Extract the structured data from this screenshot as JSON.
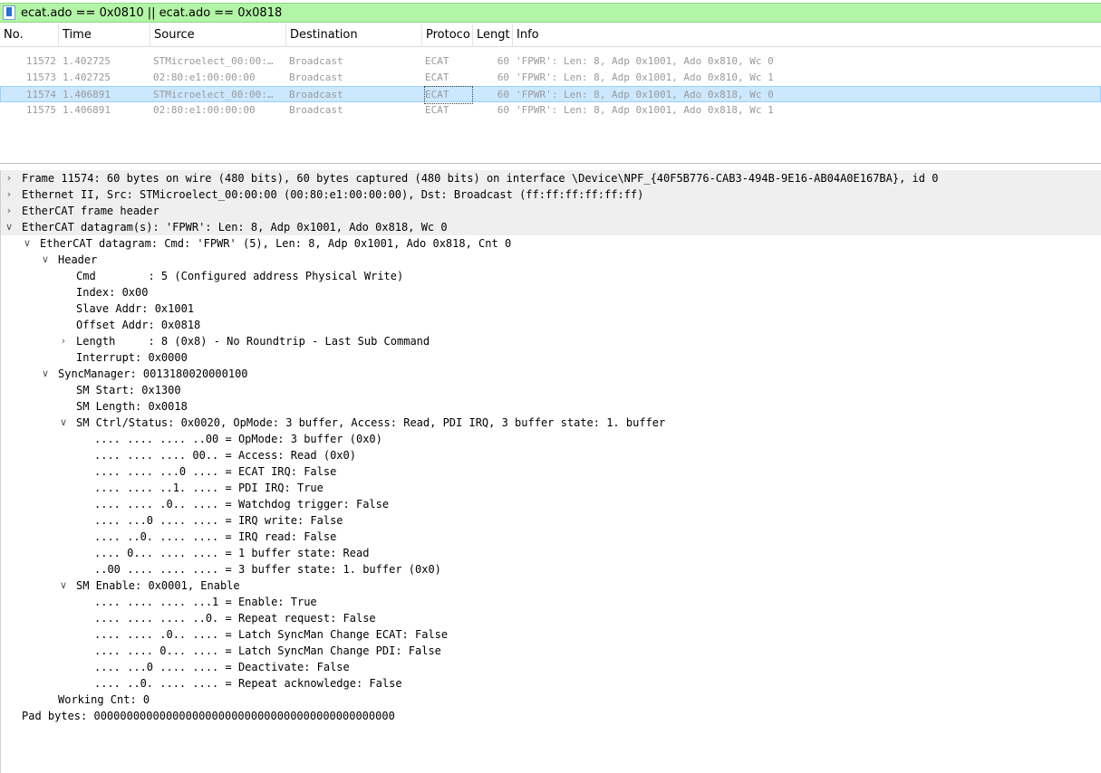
{
  "filter": {
    "text": "ecat.ado == 0x0810 || ecat.ado == 0x0818"
  },
  "columns": [
    "No.",
    "Time",
    "Source",
    "Destination",
    "Protoco",
    "Lengt",
    "Info"
  ],
  "packets": [
    {
      "no": "11572",
      "time": "1.402725",
      "source": "STMicroelect_00:00:…",
      "destination": "Broadcast",
      "protocol": "ECAT",
      "length": "60",
      "info": "'FPWR': Len: 8, Adp 0x1001, Ado 0x810, Wc 0",
      "selected": false
    },
    {
      "no": "11573",
      "time": "1.402725",
      "source": "02:80:e1:00:00:00",
      "destination": "Broadcast",
      "protocol": "ECAT",
      "length": "60",
      "info": "'FPWR': Len: 8, Adp 0x1001, Ado 0x810, Wc 1",
      "selected": false
    },
    {
      "no": "11574",
      "time": "1.406891",
      "source": "STMicroelect_00:00:…",
      "destination": "Broadcast",
      "protocol": "ECAT",
      "length": "60",
      "info": "'FPWR': Len: 8, Adp 0x1001, Ado 0x818, Wc 0",
      "selected": true
    },
    {
      "no": "11575",
      "time": "1.406891",
      "source": "02:80:e1:00:00:00",
      "destination": "Broadcast",
      "protocol": "ECAT",
      "length": "60",
      "info": "'FPWR': Len: 8, Adp 0x1001, Ado 0x818, Wc 1",
      "selected": false
    }
  ],
  "details": [
    {
      "level": 0,
      "arrow": "collapsed",
      "shaded": true,
      "text": "Frame 11574: 60 bytes on wire (480 bits), 60 bytes captured (480 bits) on interface \\Device\\NPF_{40F5B776-CAB3-494B-9E16-AB04A0E167BA}, id 0"
    },
    {
      "level": 0,
      "arrow": "collapsed",
      "shaded": true,
      "text": "Ethernet II, Src: STMicroelect_00:00:00 (00:80:e1:00:00:00), Dst: Broadcast (ff:ff:ff:ff:ff:ff)"
    },
    {
      "level": 0,
      "arrow": "collapsed",
      "shaded": true,
      "text": "EtherCAT frame header"
    },
    {
      "level": 0,
      "arrow": "expanded",
      "shaded": true,
      "text": "EtherCAT datagram(s): 'FPWR': Len: 8, Adp 0x1001, Ado 0x818, Wc 0"
    },
    {
      "level": 1,
      "arrow": "expanded",
      "shaded": false,
      "text": "EtherCAT datagram: Cmd: 'FPWR' (5), Len: 8, Adp 0x1001, Ado 0x818, Cnt 0"
    },
    {
      "level": 2,
      "arrow": "expanded",
      "shaded": false,
      "text": "Header"
    },
    {
      "level": 3,
      "arrow": "none",
      "shaded": false,
      "text": "Cmd        : 5 (Configured address Physical Write)"
    },
    {
      "level": 3,
      "arrow": "none",
      "shaded": false,
      "text": "Index: 0x00"
    },
    {
      "level": 3,
      "arrow": "none",
      "shaded": false,
      "text": "Slave Addr: 0x1001"
    },
    {
      "level": 3,
      "arrow": "none",
      "shaded": false,
      "text": "Offset Addr: 0x0818"
    },
    {
      "level": 3,
      "arrow": "collapsed",
      "shaded": false,
      "text": "Length     : 8 (0x8) - No Roundtrip - Last Sub Command"
    },
    {
      "level": 3,
      "arrow": "none",
      "shaded": false,
      "text": "Interrupt: 0x0000"
    },
    {
      "level": 2,
      "arrow": "expanded",
      "shaded": false,
      "text": "SyncManager: 0013180020000100"
    },
    {
      "level": 3,
      "arrow": "none",
      "shaded": false,
      "text": "SM Start: 0x1300"
    },
    {
      "level": 3,
      "arrow": "none",
      "shaded": false,
      "text": "SM Length: 0x0018"
    },
    {
      "level": 3,
      "arrow": "expanded",
      "shaded": false,
      "text": "SM Ctrl/Status: 0x0020, OpMode: 3 buffer, Access: Read, PDI IRQ, 3 buffer state: 1. buffer"
    },
    {
      "level": 4,
      "arrow": "none",
      "shaded": false,
      "text": ".... .... .... ..00 = OpMode: 3 buffer (0x0)"
    },
    {
      "level": 4,
      "arrow": "none",
      "shaded": false,
      "text": ".... .... .... 00.. = Access: Read (0x0)"
    },
    {
      "level": 4,
      "arrow": "none",
      "shaded": false,
      "text": ".... .... ...0 .... = ECAT IRQ: False"
    },
    {
      "level": 4,
      "arrow": "none",
      "shaded": false,
      "text": ".... .... ..1. .... = PDI IRQ: True"
    },
    {
      "level": 4,
      "arrow": "none",
      "shaded": false,
      "text": ".... .... .0.. .... = Watchdog trigger: False"
    },
    {
      "level": 4,
      "arrow": "none",
      "shaded": false,
      "text": ".... ...0 .... .... = IRQ write: False"
    },
    {
      "level": 4,
      "arrow": "none",
      "shaded": false,
      "text": ".... ..0. .... .... = IRQ read: False"
    },
    {
      "level": 4,
      "arrow": "none",
      "shaded": false,
      "text": ".... 0... .... .... = 1 buffer state: Read"
    },
    {
      "level": 4,
      "arrow": "none",
      "shaded": false,
      "text": "..00 .... .... .... = 3 buffer state: 1. buffer (0x0)"
    },
    {
      "level": 3,
      "arrow": "expanded",
      "shaded": false,
      "text": "SM Enable: 0x0001, Enable"
    },
    {
      "level": 4,
      "arrow": "none",
      "shaded": false,
      "text": ".... .... .... ...1 = Enable: True"
    },
    {
      "level": 4,
      "arrow": "none",
      "shaded": false,
      "text": ".... .... .... ..0. = Repeat request: False"
    },
    {
      "level": 4,
      "arrow": "none",
      "shaded": false,
      "text": ".... .... .0.. .... = Latch SyncMan Change ECAT: False"
    },
    {
      "level": 4,
      "arrow": "none",
      "shaded": false,
      "text": ".... .... 0... .... = Latch SyncMan Change PDI: False"
    },
    {
      "level": 4,
      "arrow": "none",
      "shaded": false,
      "text": ".... ...0 .... .... = Deactivate: False"
    },
    {
      "level": 4,
      "arrow": "none",
      "shaded": false,
      "text": ".... ..0. .... .... = Repeat acknowledge: False"
    },
    {
      "level": 2,
      "arrow": "none",
      "shaded": false,
      "text": "Working Cnt: 0"
    },
    {
      "level": 0,
      "arrow": "none",
      "shaded": false,
      "text": "Pad bytes: 0000000000000000000000000000000000000000000000"
    }
  ]
}
